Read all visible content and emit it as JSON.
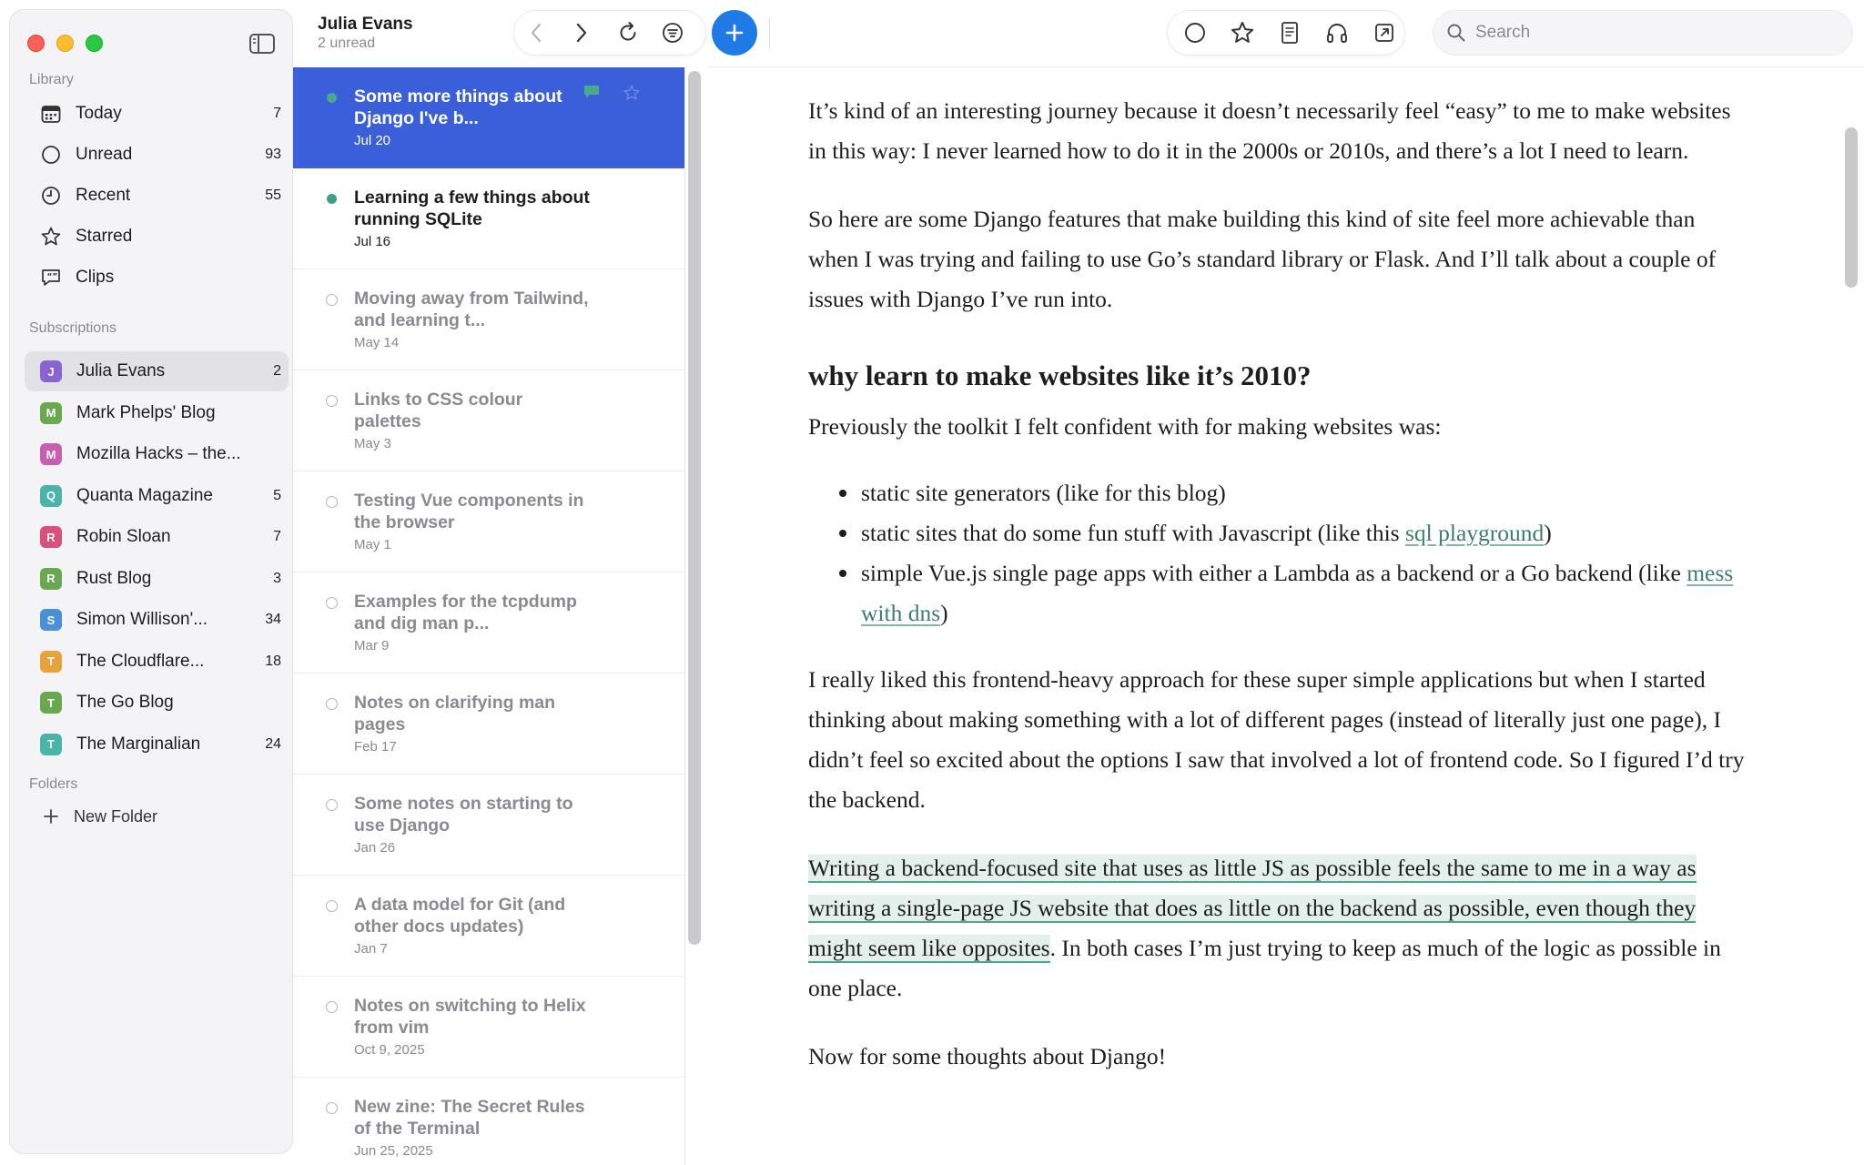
{
  "sidebar": {
    "library_label": "Library",
    "library": [
      {
        "label": "Today",
        "count": "7",
        "icon": "calendar-icon"
      },
      {
        "label": "Unread",
        "count": "93",
        "icon": "circle-icon"
      },
      {
        "label": "Recent",
        "count": "55",
        "icon": "clock-icon"
      },
      {
        "label": "Starred",
        "count": "",
        "icon": "star-icon"
      },
      {
        "label": "Clips",
        "count": "",
        "icon": "quote-bubble-icon"
      }
    ],
    "subscriptions_label": "Subscriptions",
    "subscriptions": [
      {
        "letter": "J",
        "label": "Julia Evans",
        "count": "2",
        "color": "#8a63d2"
      },
      {
        "letter": "M",
        "label": "Mark Phelps' Blog",
        "count": "",
        "color": "#6aa84f"
      },
      {
        "letter": "M",
        "label": "Mozilla Hacks – the...",
        "count": "",
        "color": "#c75fb1"
      },
      {
        "letter": "Q",
        "label": "Quanta Magazine",
        "count": "5",
        "color": "#4bb3a8"
      },
      {
        "letter": "R",
        "label": "Robin Sloan",
        "count": "7",
        "color": "#d9507a"
      },
      {
        "letter": "R",
        "label": "Rust Blog",
        "count": "3",
        "color": "#6aa84f"
      },
      {
        "letter": "S",
        "label": "Simon Willison'...",
        "count": "34",
        "color": "#4a8fd9"
      },
      {
        "letter": "T",
        "label": "The Cloudflare...",
        "count": "18",
        "color": "#e8a23a"
      },
      {
        "letter": "T",
        "label": "The Go Blog",
        "count": "",
        "color": "#6aa84f"
      },
      {
        "letter": "T",
        "label": "The Marginalian",
        "count": "24",
        "color": "#4bb3a8"
      }
    ],
    "folders_label": "Folders",
    "new_folder_label": "New Folder"
  },
  "list": {
    "title": "Julia Evans",
    "subtitle": "2 unread",
    "articles": [
      {
        "title": "Some more things about Django I've b...",
        "date": "Jul 20"
      },
      {
        "title": "Learning a few things about running SQLite",
        "date": "Jul 16"
      },
      {
        "title": "Moving away from Tailwind, and learning t...",
        "date": "May 14"
      },
      {
        "title": "Links to CSS colour palettes",
        "date": "May 3"
      },
      {
        "title": "Testing Vue components in the browser",
        "date": "May 1"
      },
      {
        "title": "Examples for the tcpdump and dig man p...",
        "date": "Mar 9"
      },
      {
        "title": "Notes on clarifying man pages",
        "date": "Feb 17"
      },
      {
        "title": "Some notes on starting to use Django",
        "date": "Jan 26"
      },
      {
        "title": "A data model for Git (and other docs updates)",
        "date": "Jan 7"
      },
      {
        "title": "Notes on switching to Helix from vim",
        "date": "Oct 9, 2025"
      },
      {
        "title": "New zine: The Secret Rules of the Terminal",
        "date": "Jun 25, 2025"
      }
    ]
  },
  "search": {
    "placeholder": "Search"
  },
  "reader": {
    "p1": "It’s kind of an interesting journey because it doesn’t necessarily feel “easy” to me to make websites in this way: I never learned how to do it in the 2000s or 2010s, and there’s a lot I need to learn.",
    "p2": "So here are some Django features that make building this kind of site feel more achievable than when I was trying and failing to use Go’s standard library or Flask. And I’ll talk about a couple of issues with Django I’ve run into.",
    "h2": "why learn to make websites like it’s 2010?",
    "p3": "Previously the toolkit I felt confident with for making websites was:",
    "li1": "static site generators (like for this blog)",
    "li2_pre": "static sites that do some fun stuff with Javascript (like this ",
    "li2_link": "sql playground",
    "li2_post": ")",
    "li3_pre": "simple Vue.js single page apps with either a Lambda as a backend or a Go backend (like ",
    "li3_link": "mess with dns",
    "li3_post": ")",
    "p4": "I really liked this frontend-heavy approach for these super simple applications but when I started thinking about making something with a lot of different pages (instead of literally just one page), I didn’t feel so excited about the options I saw that involved a lot of frontend code. So I figured I’d try the backend.",
    "p5_highlight": "Writing a backend-focused site that uses as little JS as possible feels the same to me in a way as writing a single-page JS website that does as little on the backend as possible, even though they might seem like opposites",
    "p5_rest": ". In both cases I’m just trying to keep as much of the logic as possible in one place.",
    "p6": "Now for some thoughts about Django!"
  }
}
